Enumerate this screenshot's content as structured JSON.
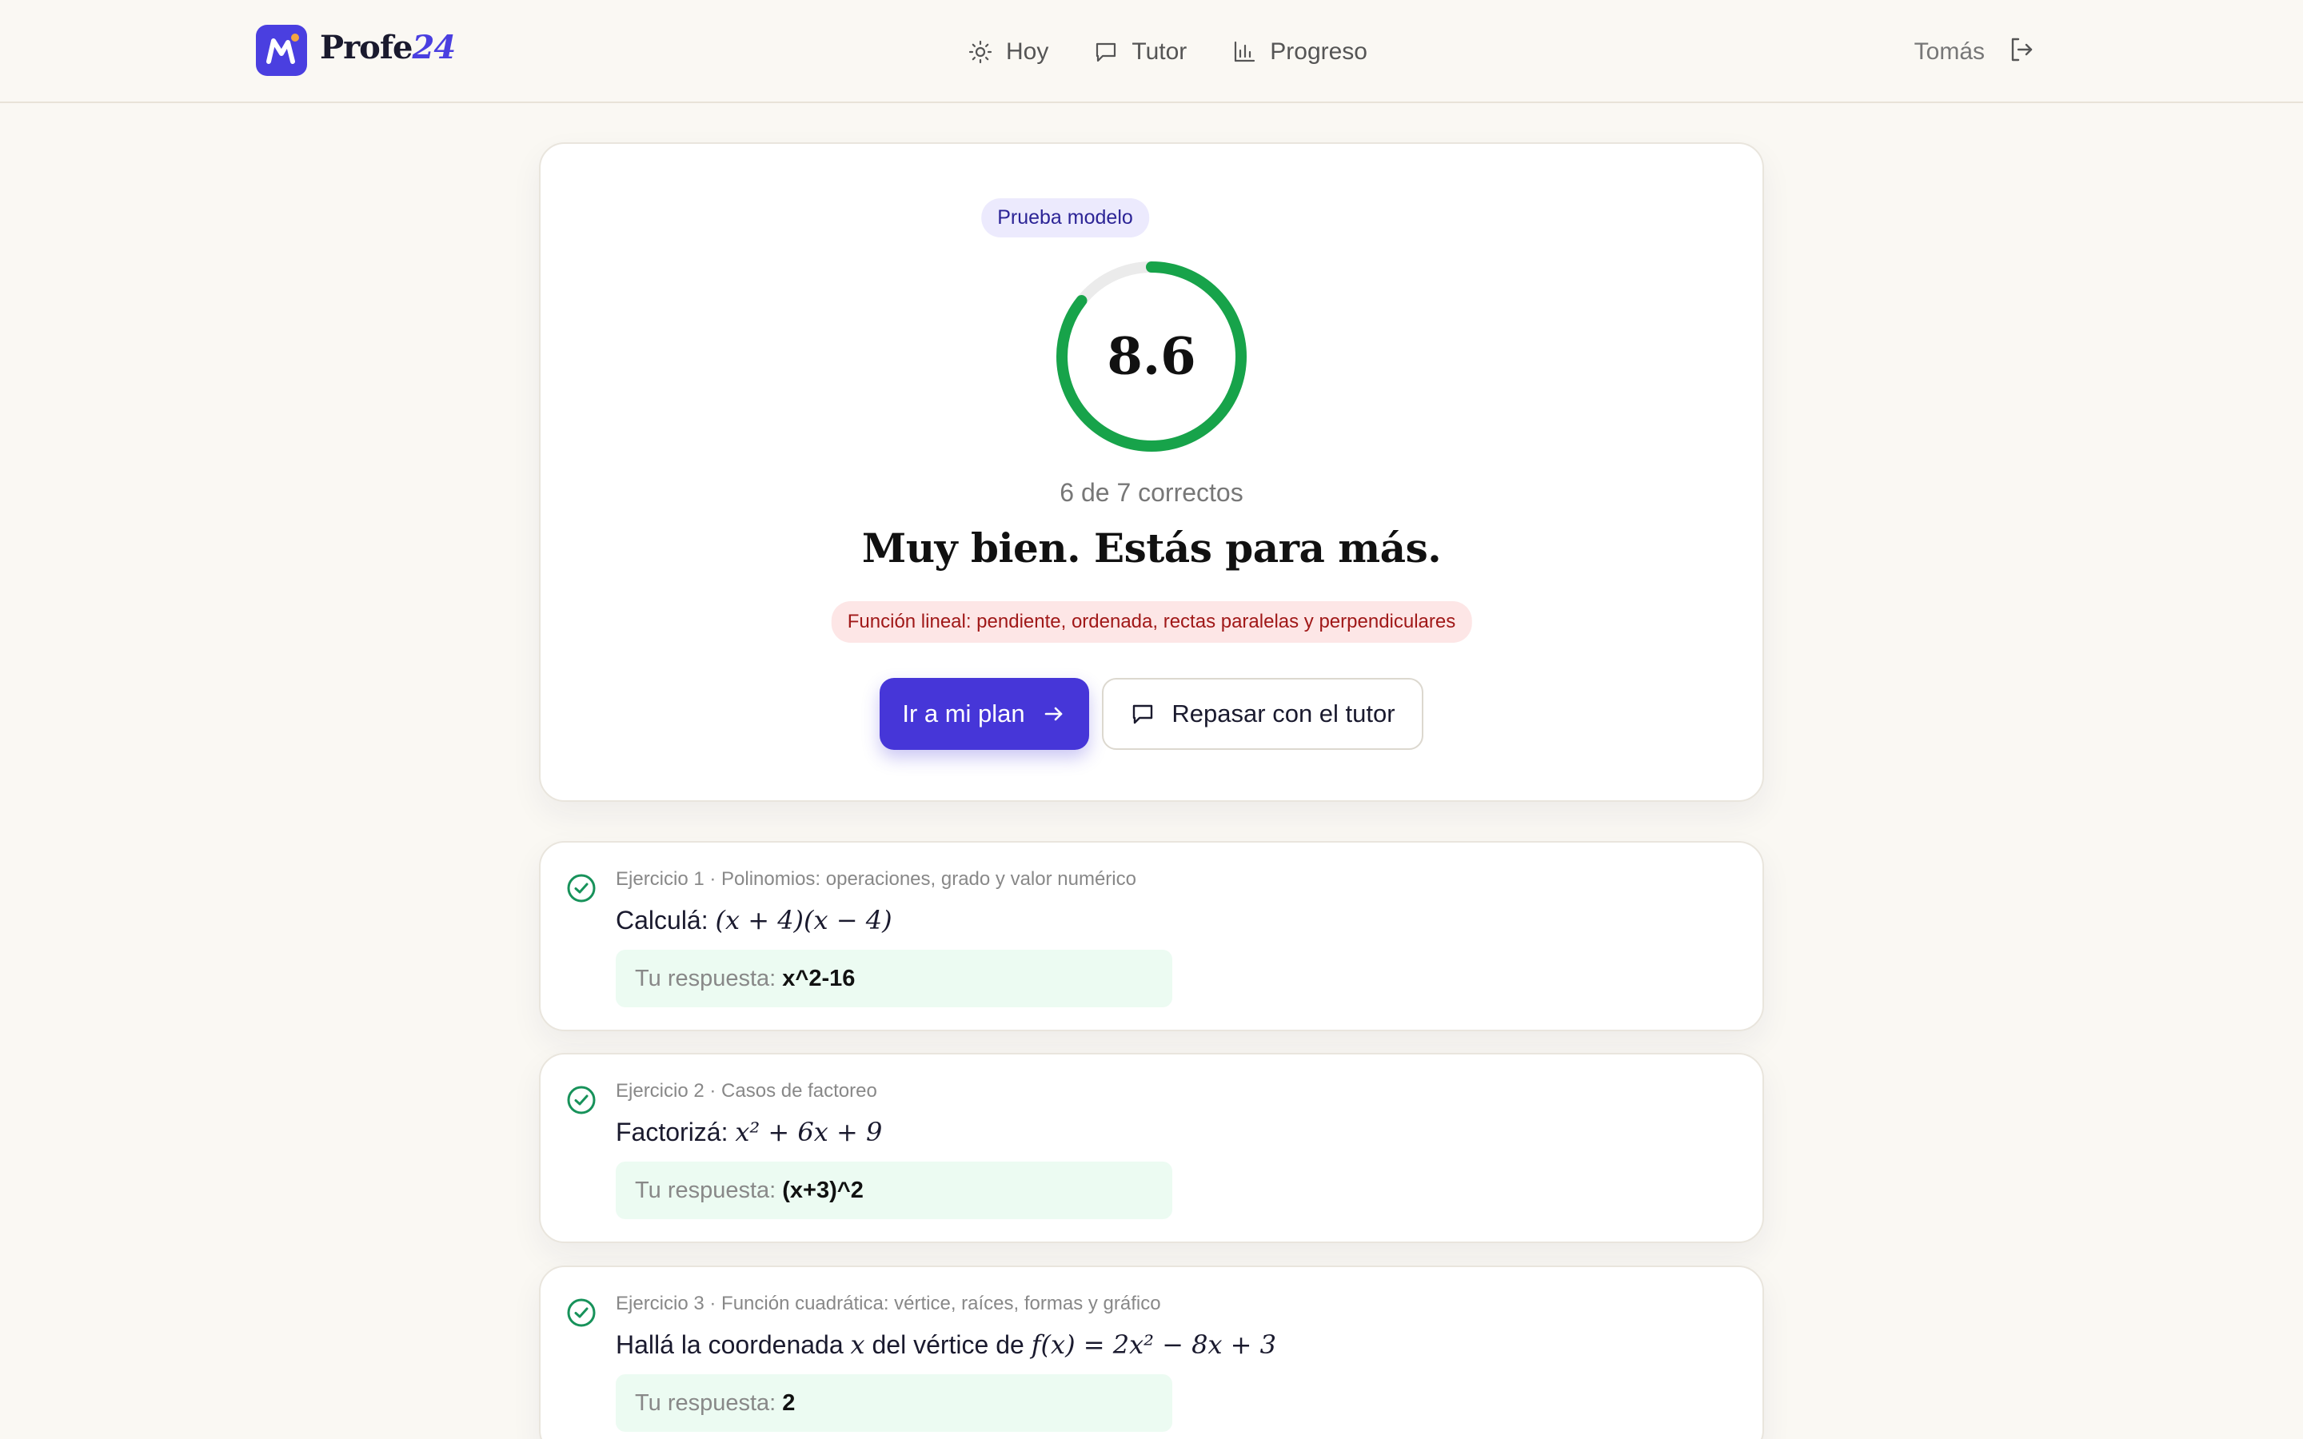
{
  "header": {
    "logo_text": "Profe",
    "logo_accent": "24",
    "nav": [
      {
        "label": "Hoy",
        "icon": "sun-icon"
      },
      {
        "label": "Tutor",
        "icon": "chat-icon"
      },
      {
        "label": "Progreso",
        "icon": "bar-chart-icon"
      }
    ],
    "user_name": "Tomás",
    "logout_icon": "logout-icon"
  },
  "result": {
    "badge": "Prueba modelo",
    "score": "8.6",
    "score_fraction": 0.857,
    "correct_text": "6 de 7 correctos",
    "headline": "Muy bien. Estás para más.",
    "topic": "Función lineal: pendiente, ordenada, rectas paralelas y perpendiculares",
    "primary_button": "Ir a mi plan",
    "secondary_button": "Repasar con el tutor",
    "colors": {
      "accent": "#4636d8",
      "success": "#17a34a",
      "warning_bg": "#fde6e6",
      "warning_text": "#a01818"
    }
  },
  "exercises": [
    {
      "meta": "Ejercicio 1 · Polinomios: operaciones, grado y valor numérico",
      "prompt": "Calculá:",
      "math": "(x + 4)(x − 4)",
      "answer_label": "Tu respuesta:",
      "answer": "x^2-16",
      "status": "correct"
    },
    {
      "meta": "Ejercicio 2 · Casos de factoreo",
      "prompt": "Factorizá:",
      "math": "x² + 6x + 9",
      "answer_label": "Tu respuesta:",
      "answer": "(x+3)^2",
      "status": "correct"
    },
    {
      "meta": "Ejercicio 3 · Función cuadrática: vértice, raíces, formas y gráfico",
      "prompt": "Hallá la coordenada",
      "math_var": "x",
      "prompt2": "del vértice de",
      "math": "f(x) = 2x² − 8x + 3",
      "answer_label": "Tu respuesta:",
      "answer": "2",
      "status": "correct"
    }
  ]
}
